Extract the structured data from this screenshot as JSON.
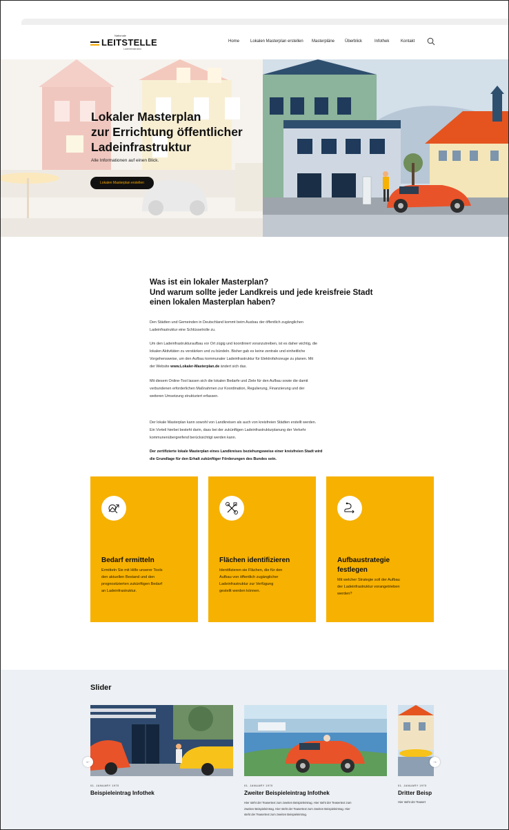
{
  "header": {
    "logo": {
      "small_top": "Nationale",
      "main": "LEITSTELLE",
      "small_bottom": "Ladeinfrastruktur"
    },
    "nav": [
      "Home",
      "Lokalen Masterplan erstellen",
      "Masterpläne",
      "Überblick",
      "Infothek",
      "Kontakt"
    ]
  },
  "hero": {
    "title_lines": [
      "Lokaler Masterplan",
      "zur Errichtung öffentlicher",
      "Ladeinfrastruktur"
    ],
    "subtitle": "Alle Informationen auf einen Blick.",
    "button": "Lokalen Masterplan erstellen"
  },
  "intro": {
    "heading_lines": [
      "Was ist ein lokaler Masterplan?",
      "Und warum sollte jeder Landkreis und jede kreisfreie Stadt",
      "einen lokalen Masterplan haben?"
    ],
    "p1": [
      "Den Städten und Gemeinden in Deutschland kommt beim Ausbau der öffentlich zugänglichen",
      "Ladeinfrastruktur eine Schlüsselrolle zu."
    ],
    "p2": [
      "Um den Ladeinfrastrukturaufbau vor Ort zügig und koordiniert voranzutreiben, ist es daher wichtig, die",
      "lokalen Aktivitäten zu verstärken und zu bündeln. Bisher gab es keine zentrale und einheitliche",
      "Vorgehensweise, um den Aufbau kommunaler Ladeinfrastruktur für Elektrofahrzeuge zu planen. Mit"
    ],
    "p2_last_prefix": "der Website ",
    "p2_last_bold": "www.Lokaler-Masterplan.de",
    "p2_last_suffix": " ändert sich das.",
    "p3": [
      "Mit diesem Online-Tool lassen sich die lokalen Bedarfe und Ziele für den Aufbau sowie die damit",
      "verbundenen erforderlichen Maßnahmen zur Koordination, Regulierung, Finanzierung und der",
      "weiteren Umsetzung strukturiert erfassen."
    ],
    "p4": [
      "Der lokale Masterplan kann sowohl von Landkreisen als auch von kreisfreien Städten erstellt werden.",
      "Ein Vorteil hierbei besteht darin, dass bei der zukünftigen Ladeinfrastrukturplanung der Verkehr",
      "kommunenübergreifend berücksichtigt werden kann."
    ],
    "p5": [
      "Der zertifizierte lokale Masterplan eines Landkreises beziehungsweise einer kreisfreien Stadt wird",
      "die Grundlage für den Erhalt zukünftiger Förderungen des Bundes sein."
    ]
  },
  "cards": [
    {
      "title_lines": [
        "Bedarf ermitteln"
      ],
      "text_lines": [
        "Ermitteln Sie mit Hilfe unserer Tools",
        "den aktuellen Bestand und den",
        "prognostizierten zukünftigen Bedarf",
        "an Ladeinfrastruktur."
      ],
      "icon": "analysis-icon"
    },
    {
      "title_lines": [
        "Flächen identifizieren"
      ],
      "text_lines": [
        "Identifizieren sie Flächen, die für den",
        "Aufbau von öffentlich zugänglicher",
        "Ladeinfrastruktur zur Verfügung",
        "gestellt werden können."
      ],
      "icon": "tools-icon"
    },
    {
      "title_lines": [
        "Aufbaustrategie",
        "festlegen"
      ],
      "text_lines": [
        "Mit welcher Strategie soll der Aufbau",
        "der Ladeinfrastruktur vorangetrieben",
        "werden?"
      ],
      "icon": "route-icon"
    }
  ],
  "slider": {
    "title": "Slider",
    "slides": [
      {
        "date": "01. JANUARY 1970",
        "title": "Beispieleintrag Infothek",
        "text_lines": []
      },
      {
        "date": "01. JANUARY 1970",
        "title": "Zweiter Beispieleintrag Infothek",
        "text_lines": [
          "Hier steht der Teasertext zum zweiten Beispieleintrag. Hier steht der Teasertext zum",
          "zweiten Beispieleintrag. Hier steht der Teasertext zum zweiten Beispieleintrag. Hier",
          "steht der Teasertext zum zweiten Beispieleintrag."
        ]
      },
      {
        "date": "01. JANUARY 1970",
        "title": "Dritter Beisp",
        "text_lines": [
          "Hier steht der Teasert"
        ]
      }
    ],
    "prev": "←",
    "next": "→"
  },
  "colors": {
    "accent": "#f7b100",
    "dark": "#111111",
    "slider_bg": "#edf0f4"
  }
}
